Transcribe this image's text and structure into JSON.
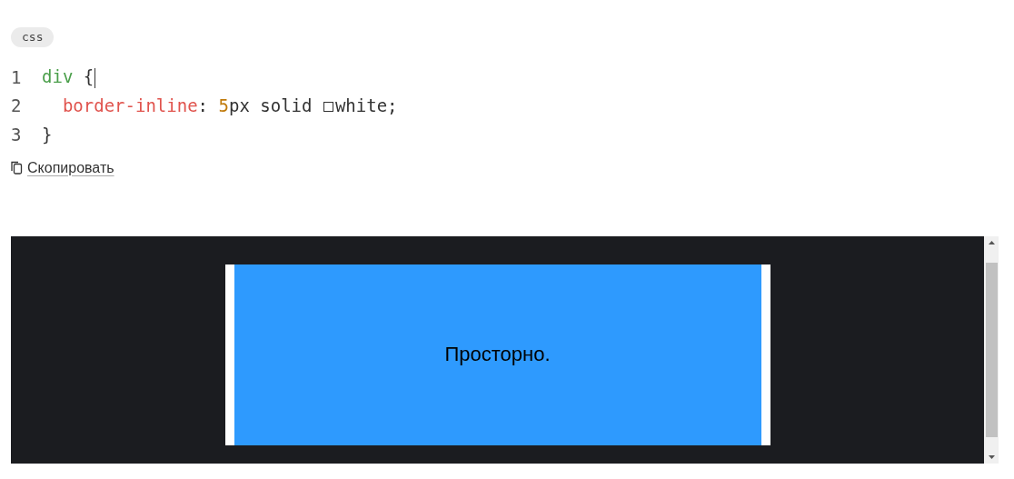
{
  "language_tag": "css",
  "code_lines": [
    {
      "number": "1",
      "caret": true,
      "indented": false,
      "tokens": [
        {
          "kind": "selector",
          "text": "div"
        },
        {
          "kind": "plain",
          "text": " {"
        }
      ]
    },
    {
      "number": "2",
      "caret": false,
      "indented": true,
      "tokens": [
        {
          "kind": "property",
          "text": "border-inline"
        },
        {
          "kind": "plain",
          "text": ": "
        },
        {
          "kind": "number",
          "text": "5"
        },
        {
          "kind": "plain",
          "text": "px solid "
        },
        {
          "kind": "swatch",
          "color": "#ffffff"
        },
        {
          "kind": "plain",
          "text": "white;"
        }
      ]
    },
    {
      "number": "3",
      "caret": false,
      "indented": false,
      "tokens": [
        {
          "kind": "plain",
          "text": "}"
        }
      ]
    }
  ],
  "copy_link": "Скопировать",
  "preview": {
    "box_text": "Просторно."
  }
}
